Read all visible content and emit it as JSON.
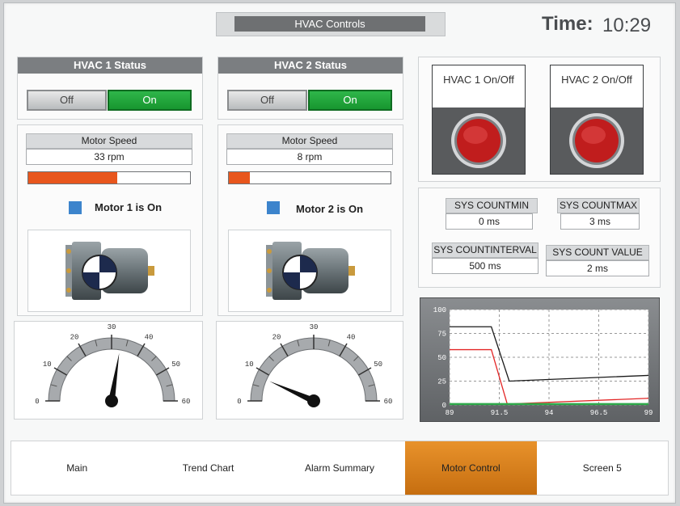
{
  "header": {
    "title": "HVAC Controls",
    "time_label": "Time:",
    "time_value": "10:29"
  },
  "hvac1": {
    "status_title": "HVAC 1 Status",
    "off_label": "Off",
    "on_label": "On",
    "motor_speed_label": "Motor Speed",
    "motor_speed_value": "33 rpm",
    "speed_bar_fraction": 0.55,
    "indicator_text": "Motor 1 is On",
    "gauge": {
      "ticks": [
        "0",
        "10",
        "20",
        "30",
        "40",
        "50",
        "60"
      ],
      "value": 33
    }
  },
  "hvac2": {
    "status_title": "HVAC 2 Status",
    "off_label": "Off",
    "on_label": "On",
    "motor_speed_label": "Motor Speed",
    "motor_speed_value": "8 rpm",
    "speed_bar_fraction": 0.13,
    "indicator_text": "Motor 2 is On",
    "gauge": {
      "ticks": [
        "0",
        "10",
        "20",
        "30",
        "40",
        "50",
        "60"
      ],
      "value": 8
    }
  },
  "pushbuttons": {
    "hvac1_label": "HVAC 1 On/Off",
    "hvac2_label": "HVAC 2 On/Off"
  },
  "sys": {
    "countmin_label": "SYS COUNTMIN",
    "countmin_value": "0 ms",
    "countmax_label": "SYS COUNTMAX",
    "countmax_value": "3 ms",
    "countinterval_label": "SYS COUNTINTERVAL",
    "countinterval_value": "500 ms",
    "countvalue_label": "SYS COUNT VALUE",
    "countvalue_value": "2 ms"
  },
  "chart_data": {
    "type": "line",
    "xlim": [
      89,
      99
    ],
    "ylim": [
      0,
      100
    ],
    "xticks": [
      "89",
      "91.5",
      "94",
      "96.5",
      "99"
    ],
    "yticks": [
      "0",
      "25",
      "50",
      "75",
      "100"
    ],
    "grid": true,
    "series": [
      {
        "color": "#1a1a1a",
        "x": [
          89,
          90.1,
          91.1,
          92.0,
          99
        ],
        "y": [
          82,
          82,
          82,
          25,
          31
        ]
      },
      {
        "color": "#e32626",
        "x": [
          89,
          90.1,
          91.1,
          91.9,
          99
        ],
        "y": [
          58,
          58,
          58,
          1,
          7
        ]
      },
      {
        "color": "#2ea84a",
        "x": [
          89,
          99
        ],
        "y": [
          1,
          1
        ]
      }
    ]
  },
  "nav": {
    "items": [
      "Main",
      "Trend Chart",
      "Alarm Summary",
      "Motor Control",
      "Screen 5"
    ],
    "active_index": 3
  }
}
